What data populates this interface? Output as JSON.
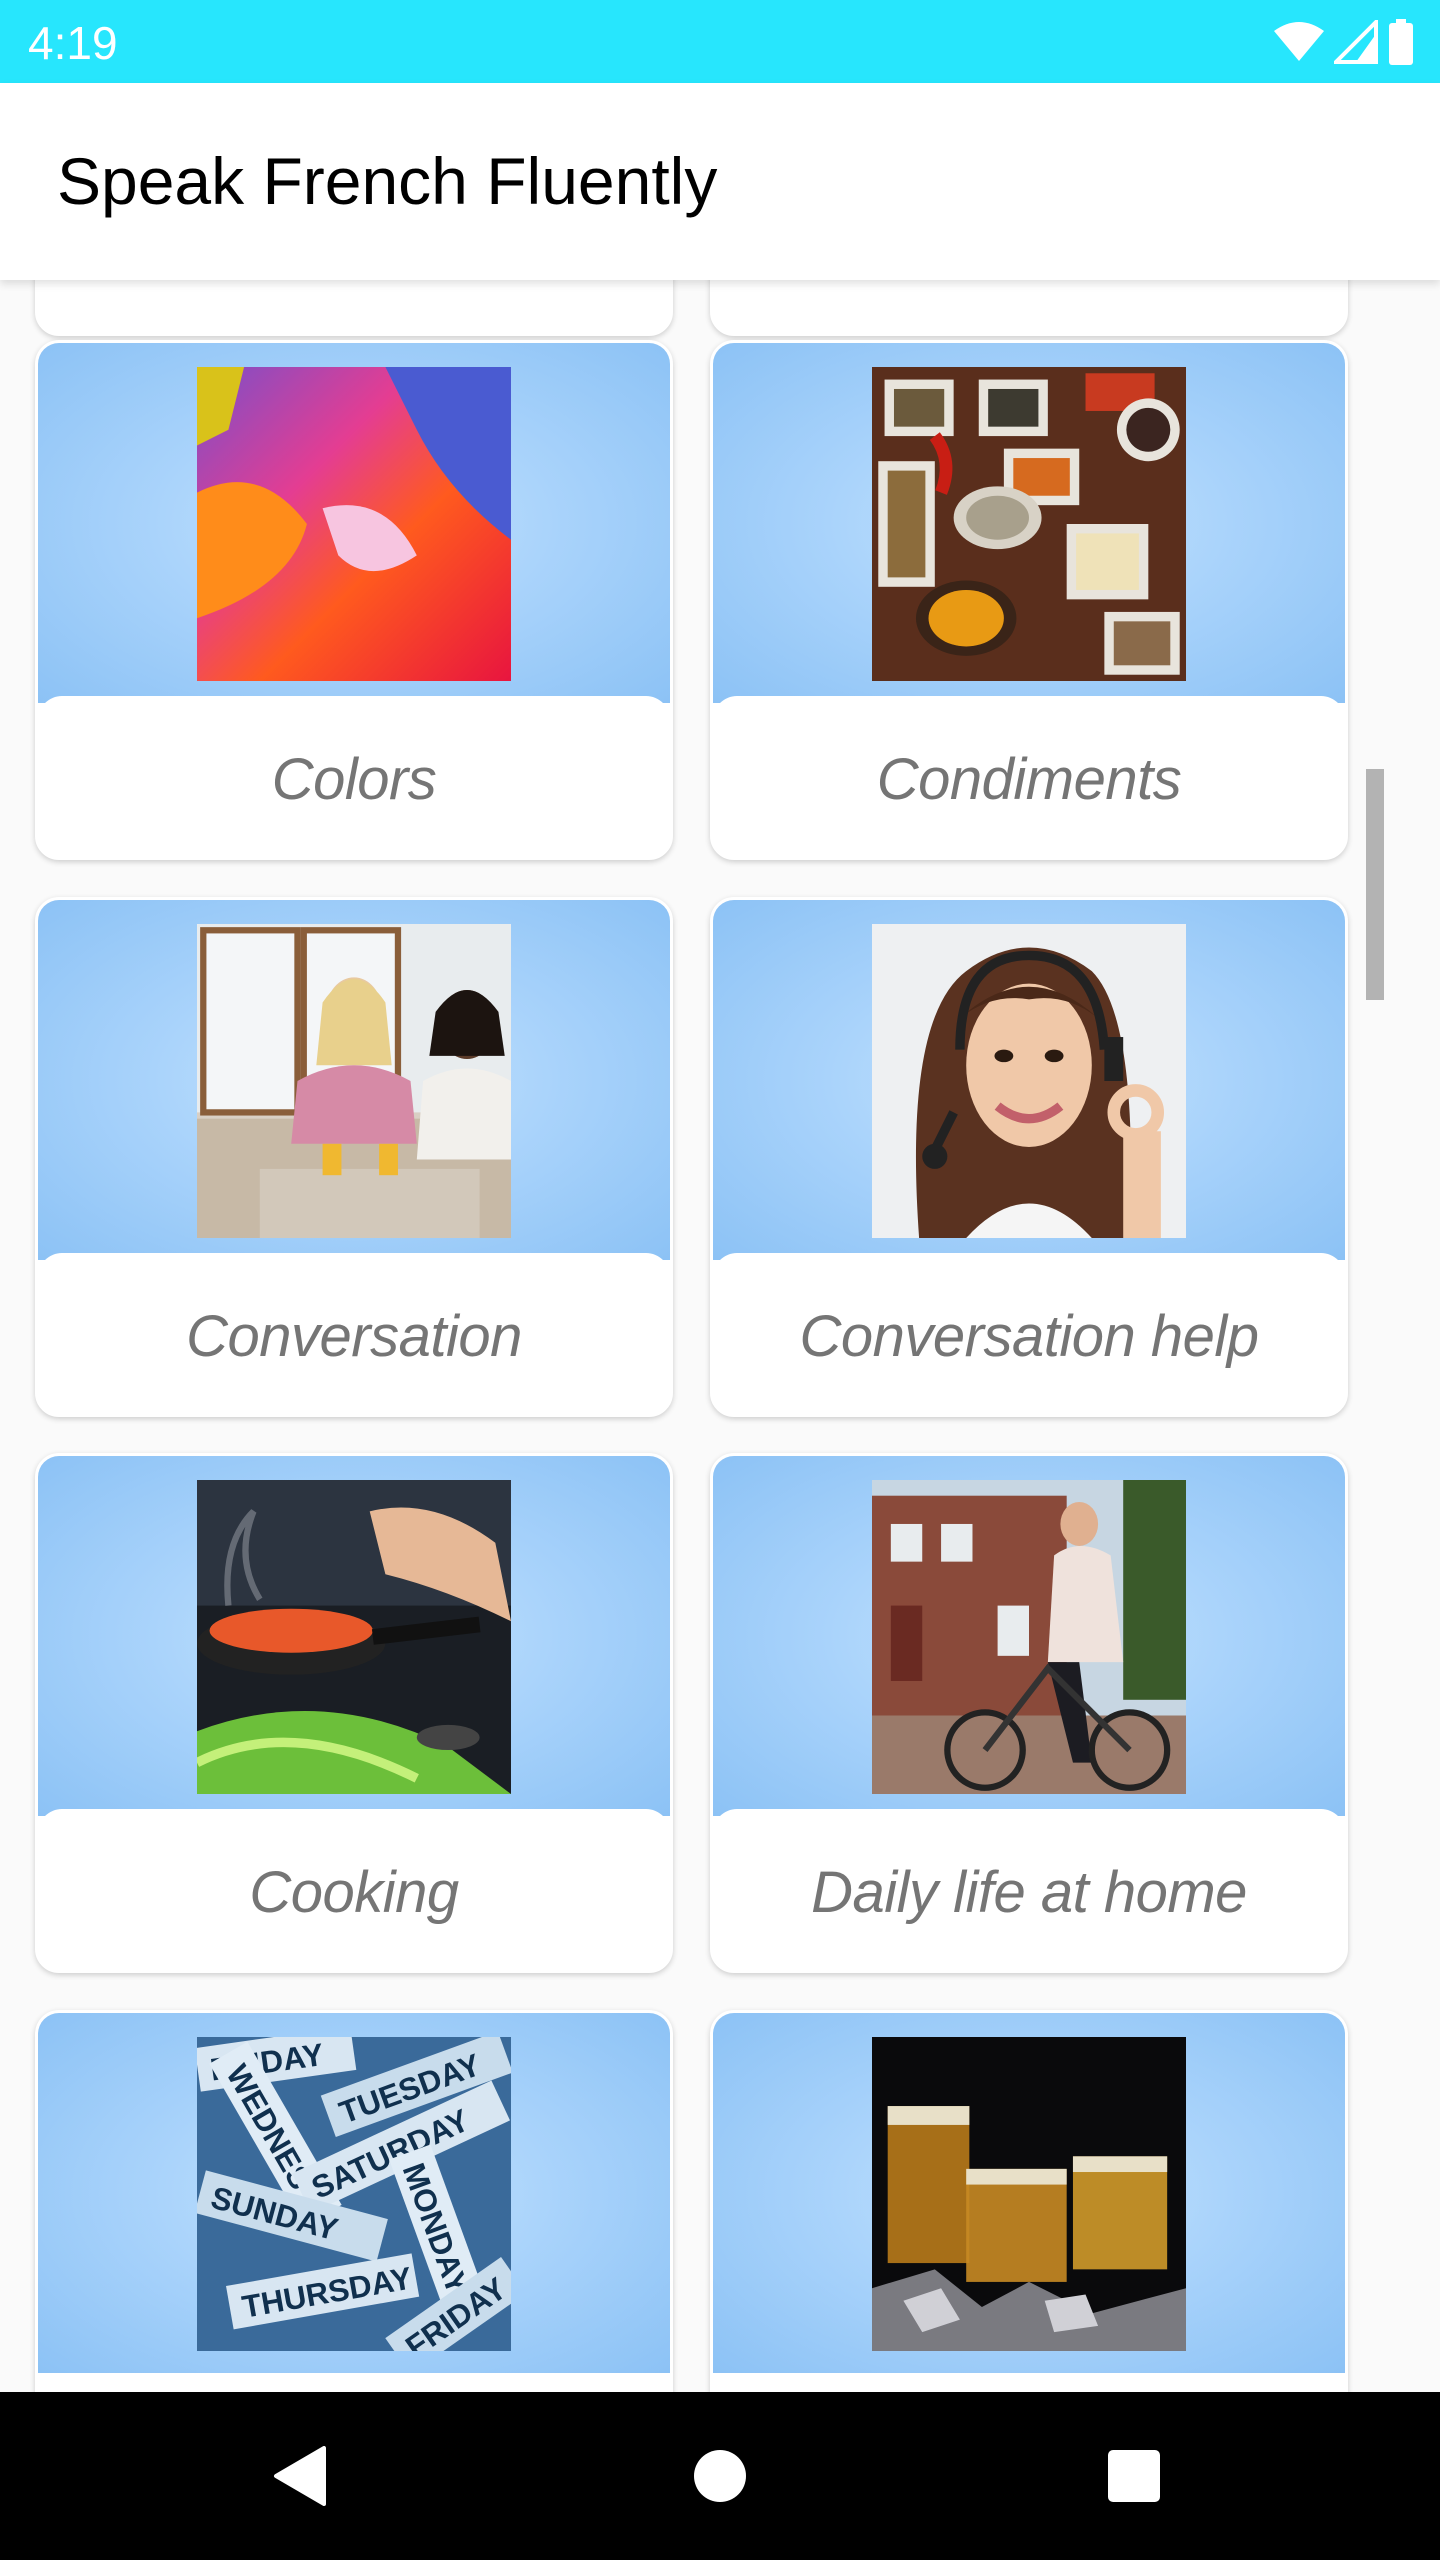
{
  "status_bar": {
    "time": "4:19",
    "icons": [
      "wifi-icon",
      "cell-signal-icon",
      "battery-icon"
    ],
    "background": "#27e6fd"
  },
  "app_bar": {
    "title": "Speak French Fluently"
  },
  "categories": [
    {
      "label": "Colors",
      "image": "paint-colors"
    },
    {
      "label": "Condiments",
      "image": "spices-bowls"
    },
    {
      "label": "Conversation",
      "image": "two-women-talking"
    },
    {
      "label": "Conversation help",
      "image": "woman-headset-ok"
    },
    {
      "label": "Cooking",
      "image": "cooking-pan"
    },
    {
      "label": "Daily life at home",
      "image": "woman-on-bicycle"
    },
    {
      "label": "",
      "image": "weekday-words"
    },
    {
      "label": "",
      "image": "drinks-glasses"
    }
  ],
  "nav_bar": {
    "buttons": [
      "back-icon",
      "home-icon",
      "recents-icon"
    ]
  }
}
